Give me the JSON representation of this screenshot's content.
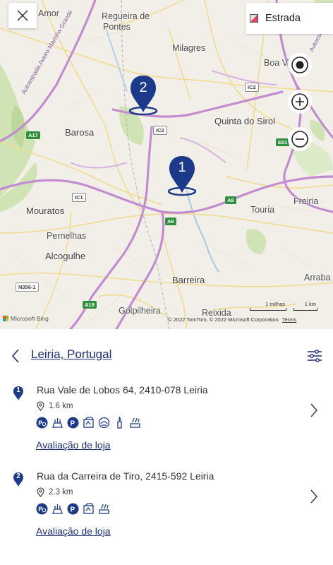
{
  "map": {
    "close_icon": "close-icon",
    "style_button_label": "Estrada",
    "labels": [
      {
        "name": "Amor",
        "big": false
      },
      {
        "name": "Regueira de",
        "big": false
      },
      {
        "name": "Pontes",
        "big": false
      },
      {
        "name": "Milagres",
        "big": false
      },
      {
        "name": "Boa Vi",
        "big": false
      },
      {
        "name": "Quinta do Sirol",
        "big": true
      },
      {
        "name": "Barosa",
        "big": true
      },
      {
        "name": "Mouratos",
        "big": true
      },
      {
        "name": "Pernelhas",
        "big": false
      },
      {
        "name": "Alcogulhe",
        "big": true
      },
      {
        "name": "Touria",
        "big": false
      },
      {
        "name": "Freiria",
        "big": false
      },
      {
        "name": "Barreira",
        "big": true
      },
      {
        "name": "Arraba",
        "big": false
      },
      {
        "name": "Golpilheira",
        "big": false
      },
      {
        "name": "Reixida",
        "big": false
      },
      {
        "name": "Autoestrada Aveiro-Marinha Grande",
        "big": false
      },
      {
        "name": "Autoestrada do Atl",
        "big": false
      }
    ],
    "road_shields": [
      "A17",
      "IC1",
      "IC2",
      "IC2",
      "A8",
      "A8",
      "A19",
      "N356-1",
      "E01"
    ],
    "pins": [
      {
        "number": "2",
        "color": "#1c3a8a"
      },
      {
        "number": "1",
        "color": "#1c3a8a"
      }
    ],
    "scale_miles": "1 milhas",
    "scale_km": "1 km",
    "bing_label": "Microsoft Bing",
    "copyright": "© 2022 TomTom, © 2022 Microsoft Corporation",
    "terms": "Terms"
  },
  "panel": {
    "location_title": "Leiria, Portugal",
    "accent": "#1c2f77",
    "stores": [
      {
        "number": "1",
        "address": "Rua Vale de Lobos 64, 2410-078 Leiria",
        "distance": "1.6 km",
        "services": [
          "wheelchair-parking-icon",
          "bakery-icon",
          "parking-icon",
          "recycling-icon",
          "coffee-icon",
          "candle-icon",
          "baking-hand-icon"
        ],
        "review_link": "Avaliação de loja"
      },
      {
        "number": "2",
        "address": "Rua da Carreira de Tiro, 2415-592 Leiria",
        "distance": "2.3 km",
        "services": [
          "wheelchair-parking-icon",
          "bakery-icon",
          "parking-icon",
          "recycling-icon",
          "baking-hand-icon"
        ],
        "review_link": "Avaliação de loja"
      }
    ]
  }
}
